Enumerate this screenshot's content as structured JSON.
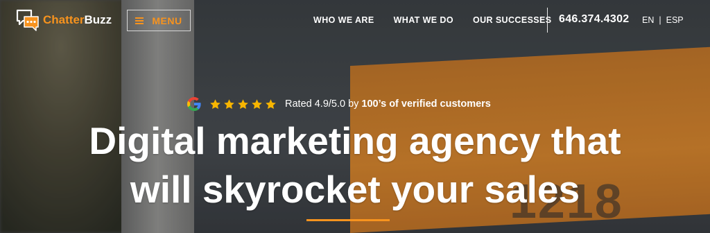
{
  "brand": {
    "name_part1": "Chatter",
    "name_part2": "Buzz",
    "accent_color": "#f7931e"
  },
  "menu_button": {
    "label": "MENU",
    "icon": "hamburger-icon"
  },
  "nav": {
    "items": [
      {
        "label": "WHO WE ARE"
      },
      {
        "label": "WHAT WE DO"
      },
      {
        "label": "OUR SUCCESSES"
      }
    ]
  },
  "contact": {
    "phone": "646.374.4302"
  },
  "languages": {
    "en": "EN",
    "separator": "|",
    "esp": "ESP"
  },
  "rating": {
    "icon": "google-icon",
    "stars": 5,
    "text": "Rated 4.9/5.0 by",
    "strong_text": "100’s of verified customers"
  },
  "hero": {
    "headline_line1": "Digital marketing agency that",
    "headline_line2": "will skyrocket your sales",
    "background_number": "1218"
  }
}
